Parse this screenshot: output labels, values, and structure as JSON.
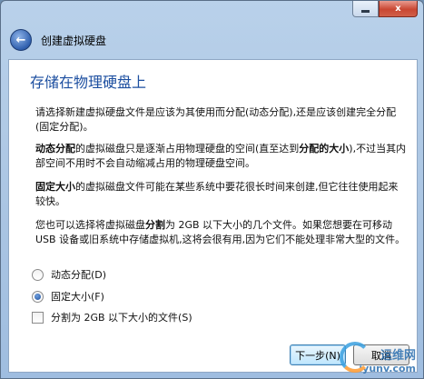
{
  "window": {
    "controls": {
      "minimize": "",
      "close": "x"
    },
    "title": "创建虚拟硬盘"
  },
  "page": {
    "heading": "存储在物理硬盘上",
    "para1": "请选择新建虚拟硬盘文件是应该为其使用而分配(动态分配),还是应该创建完全分配(固定分配)。",
    "para2_bold1": "动态分配",
    "para2_text1": "的虚拟磁盘只是逐渐占用物理硬盘的空间(直至达到",
    "para2_bold2": "分配的大小",
    "para2_text2": "),不过当其内部空间不用时不会自动缩减占用的物理硬盘空间。",
    "para3_bold": "固定大小",
    "para3_text": "的虚拟磁盘文件可能在某些系统中要花很长时间来创建,但它往往使用起来较快。",
    "para4_text1": "您也可以选择将虚拟磁盘",
    "para4_bold": "分割",
    "para4_text2": "为 2GB 以下大小的几个文件。如果您想要在可移动 USB 设备或旧系统中存储虚拟机,这将会很有用,因为它们不能处理非常大型的文件。"
  },
  "options": {
    "dynamic": {
      "label": "动态分配(D)",
      "selected": false
    },
    "fixed": {
      "label": "固定大小(F)",
      "selected": true
    },
    "split": {
      "label": "分割为 2GB 以下大小的文件(S)",
      "checked": false
    }
  },
  "buttons": {
    "next": "下一步(N)",
    "cancel": "取消"
  },
  "watermark": {
    "top": "运维网",
    "bottom": "iyunv.com"
  },
  "colors": {
    "heading": "#1d4fa0",
    "window_frame": "#b9d1ea"
  }
}
